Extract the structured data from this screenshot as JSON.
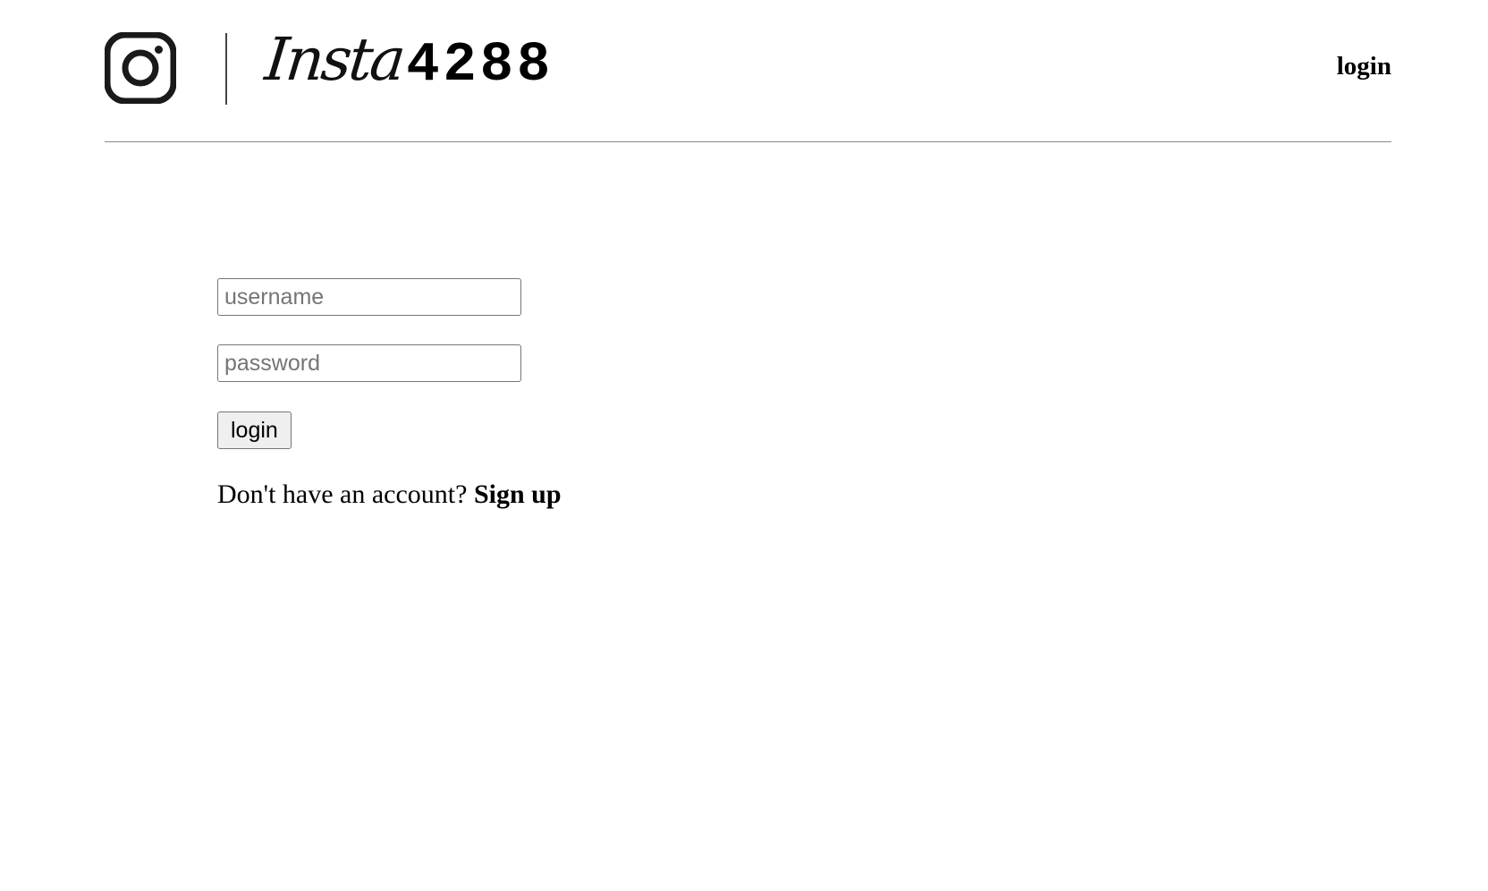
{
  "header": {
    "brand_script": "Insta",
    "brand_number": "4288",
    "nav_login": "login",
    "logo_icon": "instagram-camera-icon"
  },
  "form": {
    "username_placeholder": "username",
    "password_placeholder": "password",
    "username_value": "",
    "password_value": "",
    "login_button": "login",
    "signup_prompt": "Don't have an account?",
    "signup_link": "Sign up"
  }
}
